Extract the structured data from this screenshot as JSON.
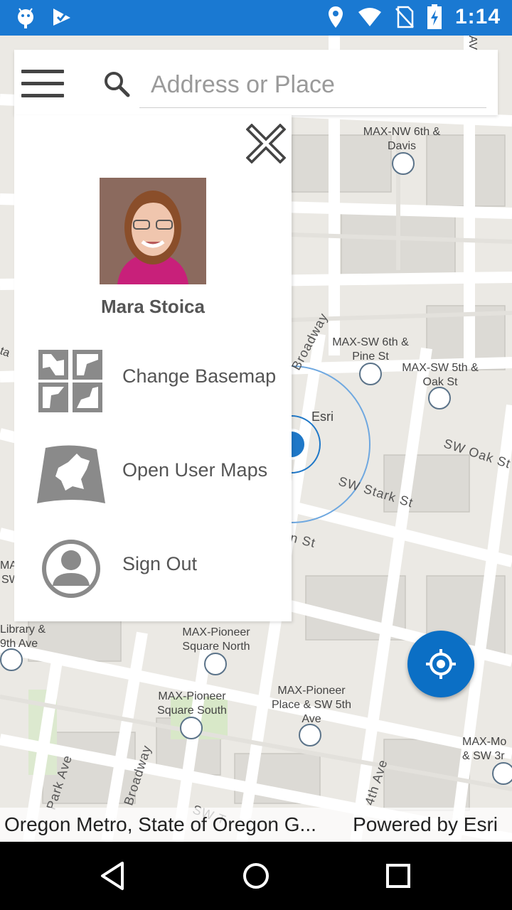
{
  "status_bar": {
    "time": "1:14",
    "icons": [
      "android-icon",
      "checkmark-icon",
      "location-icon",
      "wifi-icon",
      "no-sim-icon",
      "battery-charging-icon"
    ]
  },
  "search": {
    "placeholder": "Address or Place"
  },
  "menu": {
    "user_name": "Mara Stoica",
    "items": [
      {
        "label": "Change Basemap",
        "icon": "basemap-icon"
      },
      {
        "label": "Open User Maps",
        "icon": "map-icon"
      },
      {
        "label": "Sign Out",
        "icon": "user-icon"
      }
    ]
  },
  "map": {
    "stations": [
      "MAX-NW 6th & Davis",
      "MAX-SW 6th & Pine St",
      "MAX-SW 5th & Oak St",
      "Library & 9th Ave",
      "MAX-Pioneer Square North",
      "MAX-Pioneer Square South",
      "MAX-Pioneer Place & SW 5th Ave",
      "MAX-Mo & SW 3r"
    ],
    "streets": [
      "Broadway",
      "SW Oak St",
      "SW Stark St",
      "n St",
      "Park Ave",
      "Broadway",
      "4th Ave",
      "SW T"
    ],
    "place_label": "Esri",
    "edge_labels": [
      "ta",
      "MA",
      "SW",
      "AV"
    ]
  },
  "attribution": {
    "left": "Oregon Metro, State of Oregon G...",
    "right": "Powered by Esri"
  },
  "colors": {
    "status_bar": "#1a79d2",
    "accent": "#0b6fc5",
    "map_bg": "#ebe9e4"
  }
}
